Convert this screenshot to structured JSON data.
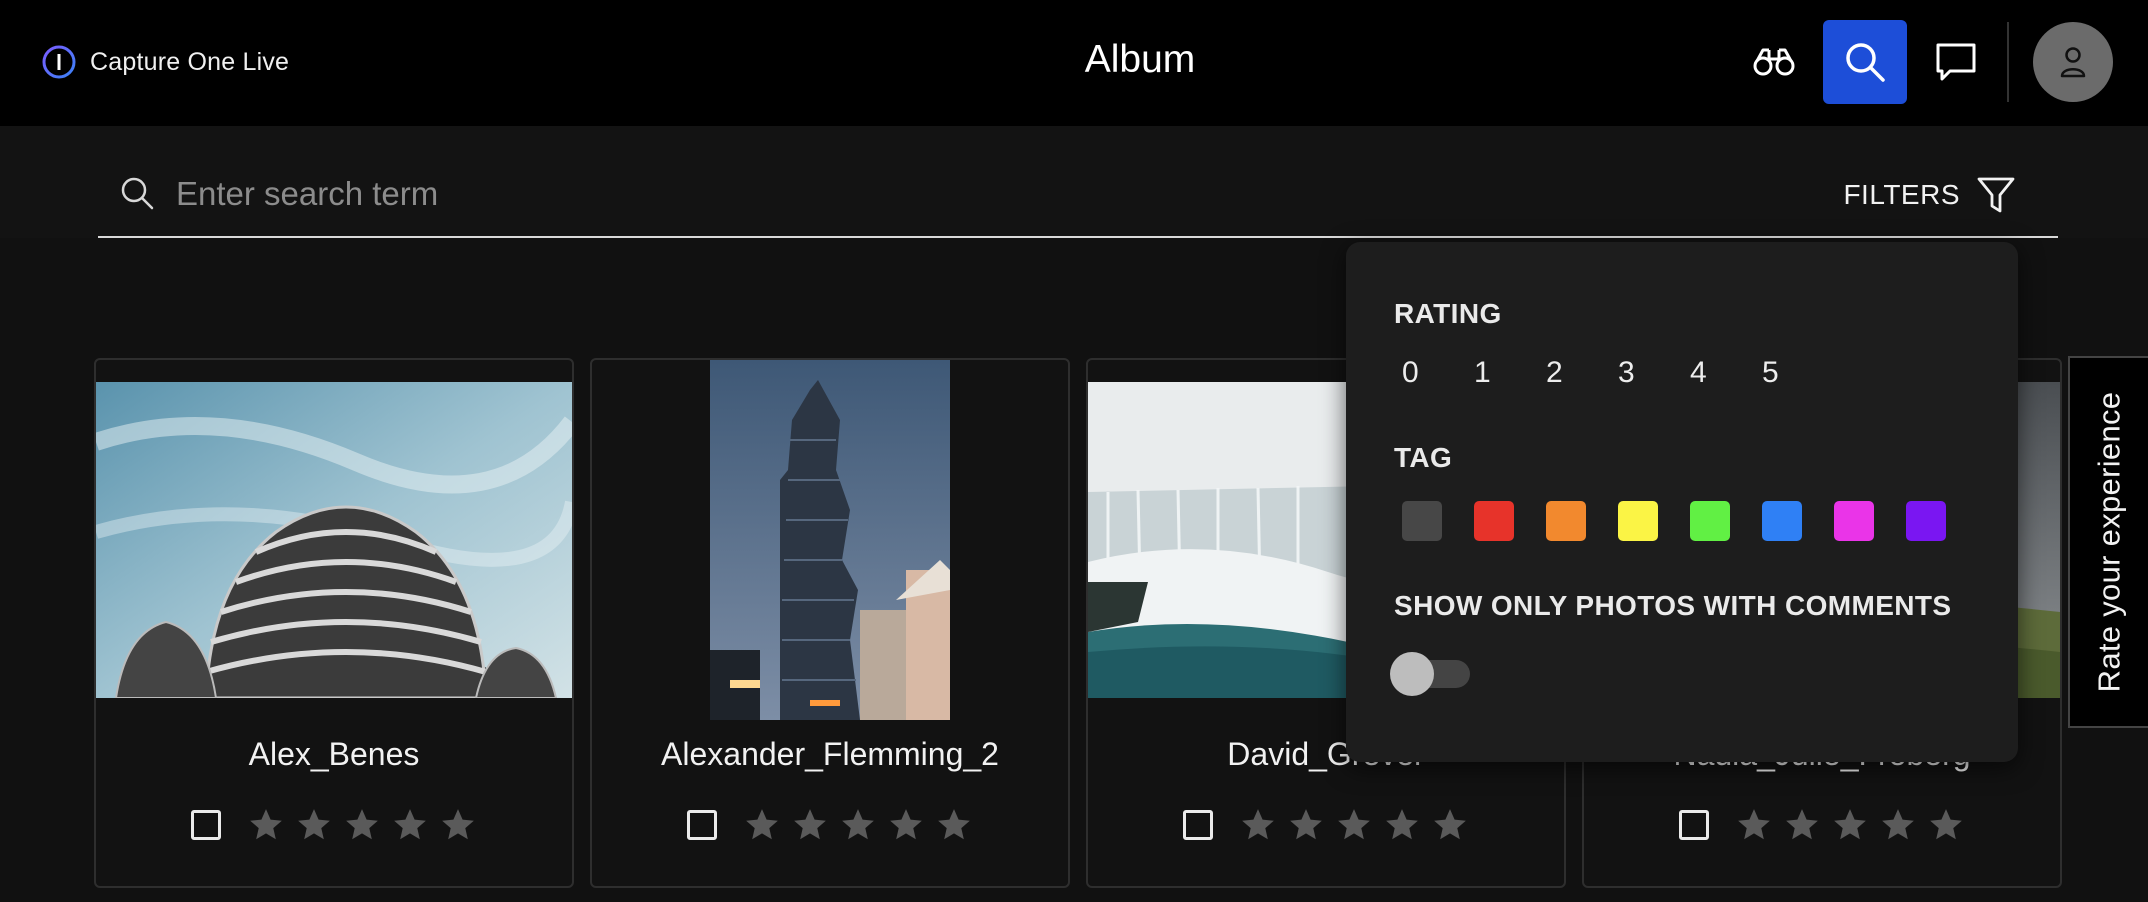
{
  "app": {
    "name": "Capture One Live",
    "page_title": "Album"
  },
  "header": {
    "icons": [
      "binoculars-icon",
      "search-icon",
      "chat-icon",
      "user-icon"
    ],
    "active_color": "#1d4ed8"
  },
  "search": {
    "placeholder": "Enter search term",
    "value": "",
    "filters_label": "FILTERS"
  },
  "filter_panel": {
    "rating_heading": "RATING",
    "rating_options": [
      "0",
      "1",
      "2",
      "3",
      "4",
      "5"
    ],
    "tag_heading": "TAG",
    "tag_colors": [
      "#474747",
      "#e7332a",
      "#f2892e",
      "#fbf445",
      "#61f044",
      "#2f80f5",
      "#ea34e8",
      "#7a16f2"
    ],
    "comments_heading": "SHOW ONLY PHOTOS WITH COMMENTS",
    "comments_toggle_on": false
  },
  "cards": [
    {
      "name": "Alex_Benes",
      "checked": false,
      "rating": 0
    },
    {
      "name": "Alexander_Flemming_2",
      "checked": false,
      "rating": 0
    },
    {
      "name": "David_Grever",
      "checked": false,
      "rating": 0
    },
    {
      "name": "Nadia_Julie_Froberg",
      "checked": false,
      "rating": 0
    }
  ],
  "side_tab": {
    "label": "Rate your experience"
  }
}
